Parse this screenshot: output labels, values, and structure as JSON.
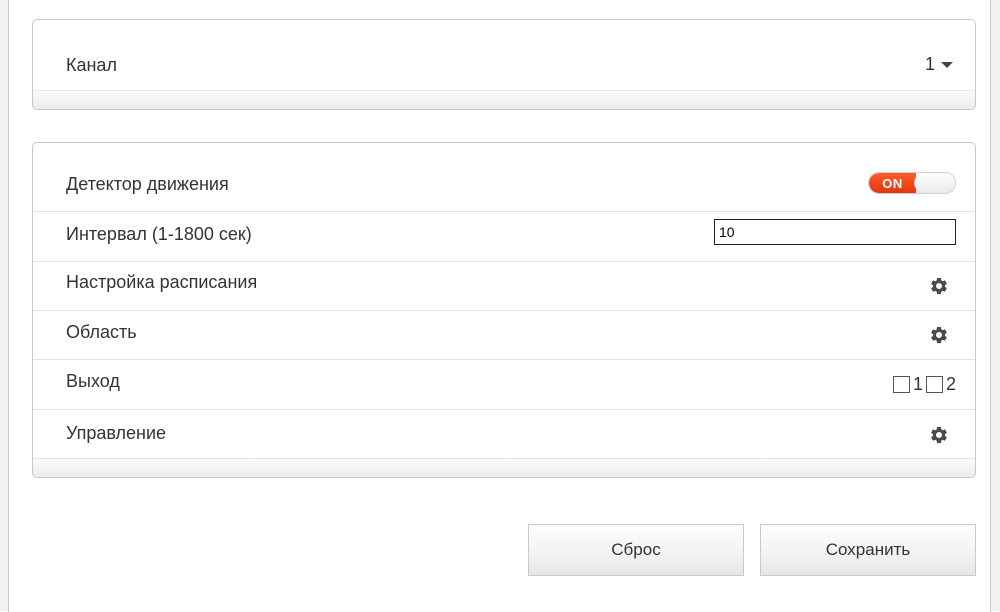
{
  "channel": {
    "label": "Канал",
    "selected": "1"
  },
  "motion": {
    "detector_label": "Детектор движения",
    "detector_state": "ON",
    "interval_label": "Интервал (1-1800 сек)",
    "interval_value": "10",
    "schedule_label": "Настройка расписания",
    "area_label": "Область",
    "output_label": "Выход",
    "outputs": [
      {
        "label": "1",
        "checked": false
      },
      {
        "label": "2",
        "checked": false
      }
    ],
    "control_label": "Управление"
  },
  "buttons": {
    "reset": "Сброс",
    "save": "Сохранить"
  },
  "colors": {
    "toggle_on": "#e8401a",
    "border": "#c9c9c9",
    "text": "#333333"
  },
  "icons": {
    "settings": "gear-icon",
    "dropdown": "caret-down-icon"
  }
}
